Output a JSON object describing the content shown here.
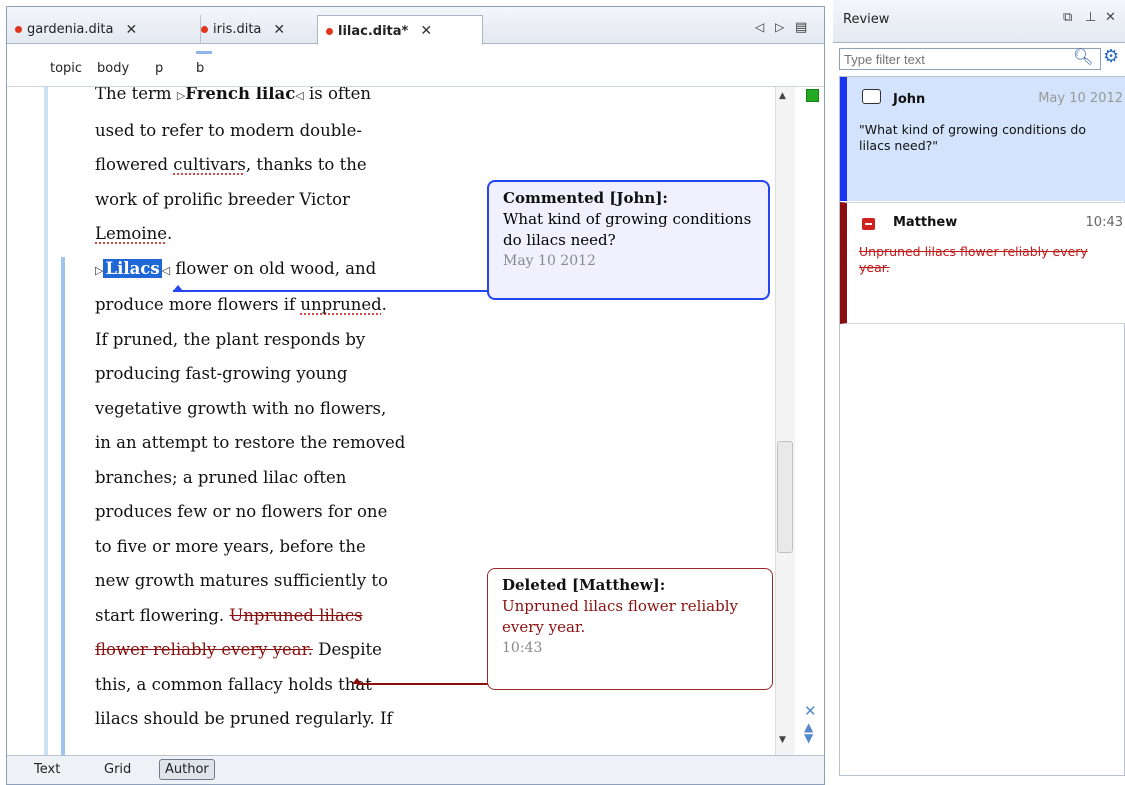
{
  "tabs": [
    {
      "label": "gardenia.dita",
      "modified": false
    },
    {
      "label": "iris.dita",
      "modified": false
    },
    {
      "label": "lilac.dita*",
      "modified": true
    }
  ],
  "tab_close_glyph": "✕",
  "breadcrumb": [
    "topic",
    "body",
    "p",
    "b"
  ],
  "document": {
    "line1_pre": "The term ",
    "line1_bold": "French lilac",
    "line1_post": " is often",
    "lines_a": [
      "used to refer to modern double-",
      "flowered cultivars, thanks to the",
      "work of prolific breeder Victor",
      "Lemoine."
    ],
    "highlight_word": "Lilacs",
    "line_hl_post": " flower on old wood, and",
    "line_unpruned_pre": "produce more flowers if ",
    "line_unpruned_word": "unpruned",
    "lines_b": [
      "If pruned, the plant responds by",
      "producing fast-growing young",
      "vegetative growth with no flowers,",
      "in an attempt to restore the removed",
      "branches; a pruned lilac often",
      "produces few or no flowers for one",
      "to five or more years, before the",
      "new growth matures sufficiently to"
    ],
    "line_start_pre": "start flowering. ",
    "deleted_part1": "Unpruned lilacs",
    "deleted_part2": "flower reliably every year.",
    "line_despite_post": " Despite",
    "lines_c": [
      "this, a common fallacy holds that",
      "lilacs should be pruned regularly. If"
    ]
  },
  "callouts": {
    "comment": {
      "title": "Commented [John]:",
      "body": "What kind of growing conditions do lilacs need?",
      "date": "May 10 2012"
    },
    "deletion": {
      "title": "Deleted [Matthew]:",
      "body": "Unpruned lilacs flower reliably every year.",
      "date": "10:43"
    }
  },
  "modes": [
    "Text",
    "Grid",
    "Author"
  ],
  "active_mode": "Author",
  "review": {
    "title": "Review",
    "filter_placeholder": "Type filter text",
    "items": [
      {
        "type": "comment",
        "author": "John",
        "time": "May 10 2012",
        "text": "\"What kind of growing conditions do lilacs need?\""
      },
      {
        "type": "deletion",
        "author": "Matthew",
        "time": "10:43",
        "text": "Unpruned lilacs flower reliably every year."
      }
    ]
  },
  "colors": {
    "comment_accent": "#1a34f2",
    "deletion_accent": "#8a0f0f",
    "highlight": "#1f66d6",
    "status_ok": "#22aa22"
  },
  "icons": [
    "tab-scroll-left-icon",
    "tab-scroll-right-icon",
    "tab-list-icon",
    "restore-icon",
    "pin-icon",
    "close-icon",
    "search-icon",
    "settings-icon",
    "comment-icon",
    "deletion-icon",
    "next-change-icon",
    "clear-icon"
  ]
}
